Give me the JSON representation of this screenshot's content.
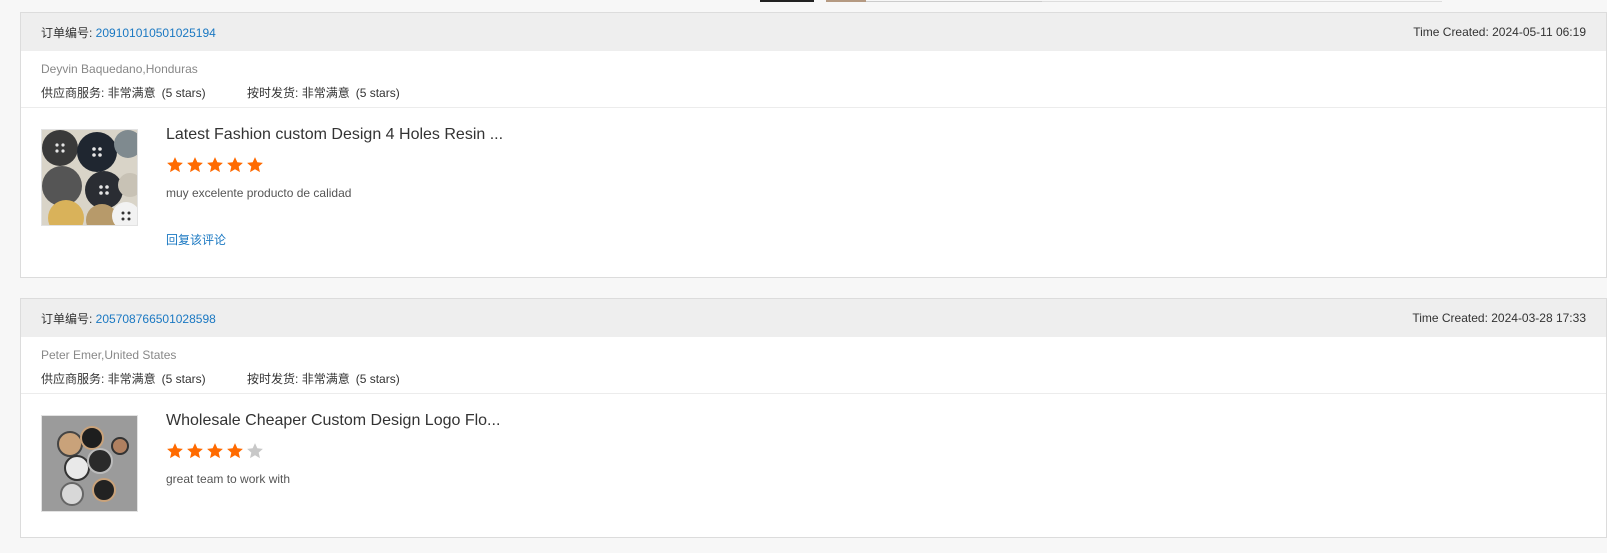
{
  "colors": {
    "link": "#1a78c2",
    "star_on": "#ff6a00",
    "star_off": "#c8c8c8",
    "header_bg": "#eeeeee"
  },
  "reviews": [
    {
      "order_label": "订单编号: ",
      "order_no": "209101010501025194",
      "time_created": "Time Created: 2024-05-11 06:19",
      "buyer": "Deyvin Baquedano,Honduras",
      "supplier_service_label": "供应商服务: 非常满意",
      "supplier_service_stars": "(5 stars)",
      "on_time_label": "按时发货: 非常满意",
      "on_time_stars": "(5 stars)",
      "product_title": "Latest Fashion custom Design 4 Holes Resin ...",
      "rating": 5,
      "comment": "muy excelente producto de calidad",
      "reply_label": "回复该评论"
    },
    {
      "order_label": "订单编号: ",
      "order_no": "205708766501028598",
      "time_created": "Time Created: 2024-03-28 17:33",
      "buyer": "Peter Emer,United States",
      "supplier_service_label": "供应商服务: 非常满意",
      "supplier_service_stars": "(5 stars)",
      "on_time_label": "按时发货: 非常满意",
      "on_time_stars": "(5 stars)",
      "product_title": "Wholesale Cheaper Custom Design Logo Flo...",
      "rating": 4,
      "comment": "great team to work with"
    }
  ]
}
